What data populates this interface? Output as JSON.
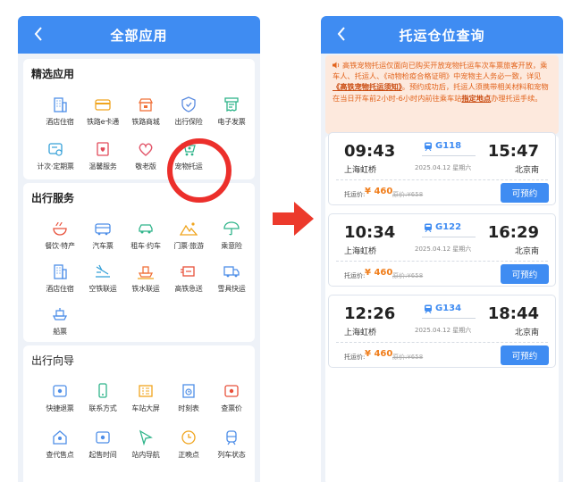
{
  "left_screen": {
    "header": {
      "title": "全部应用"
    },
    "sections": [
      {
        "title": "精选应用",
        "items": [
          {
            "label": "酒店住宿",
            "icon": "building-icon"
          },
          {
            "label": "铁路e卡通",
            "icon": "card-icon"
          },
          {
            "label": "铁路商城",
            "icon": "shop-icon"
          },
          {
            "label": "出行保险",
            "icon": "shield-icon"
          },
          {
            "label": "电子发票",
            "icon": "invoice-icon"
          },
          {
            "label": "计次·定期票",
            "icon": "ticket-icon"
          },
          {
            "label": "温馨服务",
            "icon": "service-icon"
          },
          {
            "label": "敬老版",
            "icon": "heart-icon"
          },
          {
            "label": "宠物托运",
            "icon": "pet-cart-icon"
          }
        ]
      },
      {
        "title": "出行服务",
        "items": [
          {
            "label": "餐饮·特产",
            "icon": "food-icon"
          },
          {
            "label": "汽车票",
            "icon": "bus-icon"
          },
          {
            "label": "租车·约车",
            "icon": "car-icon"
          },
          {
            "label": "门票·旅游",
            "icon": "mountain-icon"
          },
          {
            "label": "乘意险",
            "icon": "umbrella-icon"
          },
          {
            "label": "酒店住宿",
            "icon": "building-icon"
          },
          {
            "label": "空铁联运",
            "icon": "plane-rail-icon"
          },
          {
            "label": "铁水联运",
            "icon": "ship-rail-icon"
          },
          {
            "label": "高铁急送",
            "icon": "express-icon"
          },
          {
            "label": "雪具快运",
            "icon": "truck-icon"
          },
          {
            "label": "船票",
            "icon": "boat-icon"
          }
        ]
      },
      {
        "title": "出行向导",
        "items": [
          {
            "label": "快捷退票",
            "icon": "refund-icon"
          },
          {
            "label": "联系方式",
            "icon": "phone-icon"
          },
          {
            "label": "车站大屏",
            "icon": "screen-icon"
          },
          {
            "label": "时刻表",
            "icon": "timetable-icon"
          },
          {
            "label": "查票价",
            "icon": "price-icon"
          },
          {
            "label": "查代售点",
            "icon": "location-icon"
          },
          {
            "label": "起售时间",
            "icon": "sale-time-icon"
          },
          {
            "label": "站内导航",
            "icon": "navigation-icon"
          },
          {
            "label": "正晚点",
            "icon": "clock-icon"
          },
          {
            "label": "列车状态",
            "icon": "train-status-icon"
          }
        ]
      }
    ]
  },
  "right_screen": {
    "header": {
      "title": "托运仓位查询"
    },
    "notice": {
      "text_1": "高铁宠物托运仅面向已购买开放宠物托运车次车票旅客开放，乘车人、托运人、《动物检疫合格证明》中宠物主人务必一致，详见",
      "link_1": "《高铁宠物托运须知》",
      "text_2": "。预约成功后，托运人须携带相关材料和宠物在当日开车前2小时-6小时内前往乘车站",
      "link_2": "指定地点",
      "text_3": "办理托运手续。"
    },
    "trips": [
      {
        "dep_time": "09:43",
        "arr_time": "15:47",
        "train_no": "G118",
        "dep_station": "上海虹桥",
        "arr_station": "北京南",
        "date": "2025.04.12 星期六",
        "price_label": "托运价:",
        "price": "¥ 460",
        "orig_price": "原价:¥658",
        "button": "可预约"
      },
      {
        "dep_time": "10:34",
        "arr_time": "16:29",
        "train_no": "G122",
        "dep_station": "上海虹桥",
        "arr_station": "北京南",
        "date": "2025.04.12 星期六",
        "price_label": "托运价:",
        "price": "¥ 460",
        "orig_price": "原价:¥658",
        "button": "可预约"
      },
      {
        "dep_time": "12:26",
        "arr_time": "18:44",
        "train_no": "G134",
        "dep_station": "上海虹桥",
        "arr_station": "北京南",
        "date": "2025.04.12 星期六",
        "price_label": "托运价:",
        "price": "¥ 460",
        "orig_price": "原价:¥658",
        "button": "可预约"
      }
    ]
  },
  "colors": {
    "primary": "#3f8cf2",
    "highlight_ring": "#ec2f2b",
    "arrow": "#ec3a2c",
    "price": "#f07d1a",
    "notice_text": "#e2641d"
  }
}
